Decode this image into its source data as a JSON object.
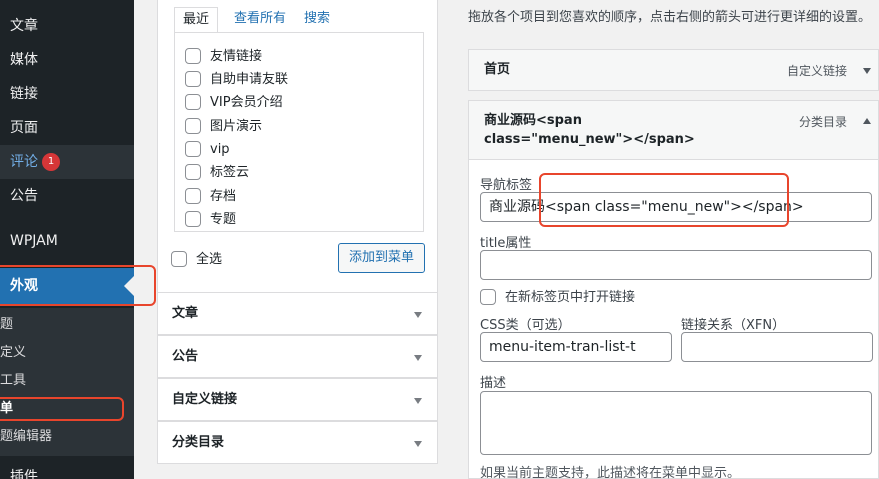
{
  "sidebar": {
    "items": [
      {
        "label": "文章"
      },
      {
        "label": "媒体"
      },
      {
        "label": "链接"
      },
      {
        "label": "页面"
      },
      {
        "label": "评论",
        "badge": "1"
      },
      {
        "label": "公告"
      },
      {
        "label": "WPJAM"
      },
      {
        "label": "外观"
      }
    ],
    "submenu": [
      "题",
      "定义",
      "工具",
      "单",
      "题编辑器"
    ],
    "bottom_item": "插件"
  },
  "menu_source": {
    "tabs": [
      "最近",
      "查看所有",
      "搜索"
    ],
    "items": [
      "友情链接",
      "自助申请友联",
      "VIP会员介绍",
      "图片演示",
      "vip",
      "标签云",
      "存档",
      "专题"
    ],
    "select_all": "全选",
    "add_button": "添加到菜单"
  },
  "accordion": [
    {
      "title": "文章"
    },
    {
      "title": "公告"
    },
    {
      "title": "自定义链接"
    },
    {
      "title": "分类目录"
    }
  ],
  "menu_structure": {
    "instructions": "拖放各个项目到您喜欢的顺序，点击右侧的箭头可进行更详细的设置。",
    "items": [
      {
        "title": "首页",
        "type": "自定义链接"
      },
      {
        "title_line1": "商业源码<span",
        "title_line2": "class=\"menu_new\"></span>",
        "type": "分类目录"
      }
    ],
    "fields": {
      "nav_label_label": "导航标签",
      "nav_label_value": "商业源码<span class=\"menu_new\"></span>",
      "title_attr_label": "title属性",
      "title_attr_value": "",
      "new_tab_label": "在新标签页中打开链接",
      "css_class_label": "CSS类（可选）",
      "css_class_value": "menu-item-tran-list-t",
      "xfn_label": "链接关系（XFN）",
      "xfn_value": "",
      "desc_label": "描述",
      "desc_value": "",
      "desc_help": "如果当前主题支持，此描述将在菜单中显示。"
    }
  },
  "colors": {
    "sidebar_bg": "#1d2327",
    "accent": "#2271b1",
    "highlight": "#e8452c",
    "badge": "#d63638"
  }
}
